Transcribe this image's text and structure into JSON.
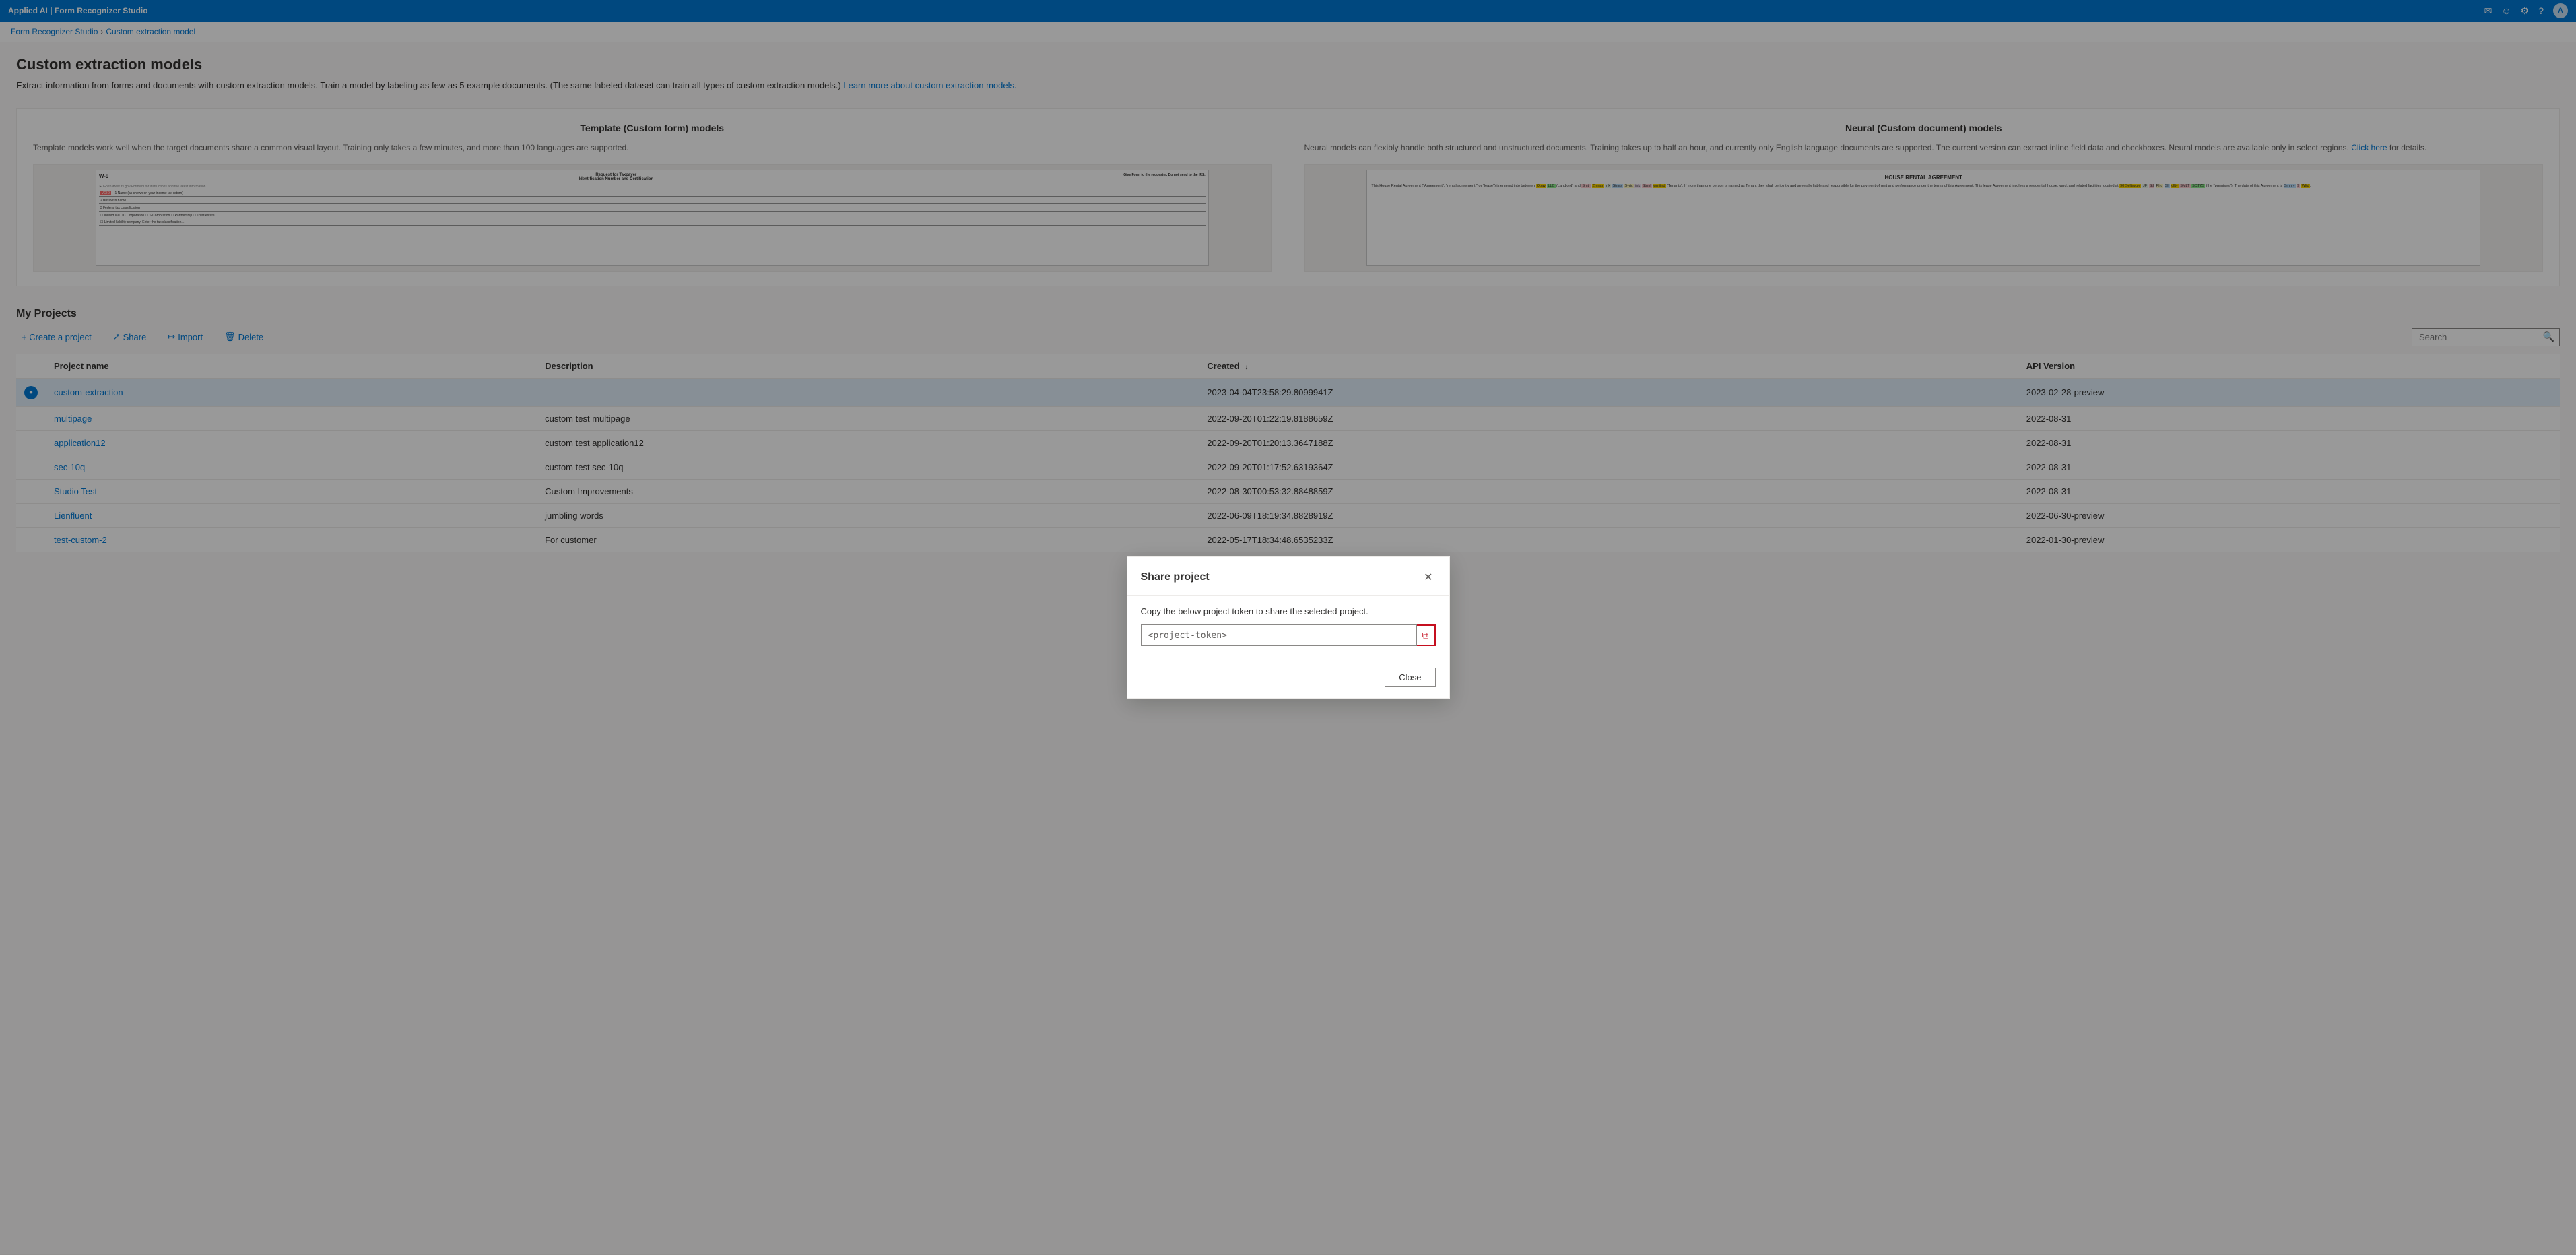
{
  "app": {
    "title": "Applied AI | Form Recognizer Studio",
    "topbar_icons": [
      "mail",
      "smiley",
      "settings",
      "help",
      "user"
    ]
  },
  "breadcrumb": {
    "parent": "Form Recognizer Studio",
    "current": "Custom extraction model"
  },
  "page": {
    "title": "Custom extraction models",
    "description": "Extract information from forms and documents with custom extraction models. Train a model by labeling as few as 5 example documents. (The same labeled dataset can train all types of custom extraction models.)",
    "link_text": "Learn more about custom extraction models.",
    "link_href": "#"
  },
  "template_card": {
    "title": "Template (Custom form) models",
    "description": "Template models work well when the target documents share a common visual layout. Training only takes a few minutes, and more than 100 languages are supported."
  },
  "neural_card": {
    "title": "Neural (Custom document) models",
    "description": "Neural models can flexibly handle both structured and unstructured documents. Training takes up to half an hour, and currently only English language documents are supported. The current version can extract inline field data and checkboxes. Neural models are available only in select regions.",
    "link_text": "Click here",
    "link_href": "#",
    "description_suffix": " for details."
  },
  "projects_section": {
    "title": "My Projects",
    "toolbar": {
      "create": "+ Create a project",
      "share": "Share",
      "import": "Import",
      "delete": "Delete"
    },
    "search_placeholder": "Search"
  },
  "table": {
    "columns": [
      "",
      "Project name",
      "Description",
      "Created ↓",
      "API Version"
    ],
    "rows": [
      {
        "indicator": true,
        "name": "custom-extraction",
        "description": "",
        "created": "2023-04-04T23:58:29.8099941Z",
        "api_version": "2023-02-28-preview"
      },
      {
        "indicator": false,
        "name": "multipage",
        "description": "custom test multipage",
        "created": "2022-09-20T01:22:19.8188659Z",
        "api_version": "2022-08-31"
      },
      {
        "indicator": false,
        "name": "application12",
        "description": "custom test application12",
        "created": "2022-09-20T01:20:13.3647188Z",
        "api_version": "2022-08-31"
      },
      {
        "indicator": false,
        "name": "sec-10q",
        "description": "custom test sec-10q",
        "created": "2022-09-20T01:17:52.6319364Z",
        "api_version": "2022-08-31"
      },
      {
        "indicator": false,
        "name": "Studio Test",
        "description": "Custom Improvements",
        "created": "2022-08-30T00:53:32.8848859Z",
        "api_version": "2022-08-31"
      },
      {
        "indicator": false,
        "name": "Lienfluent",
        "description": "jumbling words",
        "created": "2022-06-09T18:19:34.8828919Z",
        "api_version": "2022-06-30-preview"
      },
      {
        "indicator": false,
        "name": "test-custom-2",
        "description": "For customer",
        "created": "2022-05-17T18:34:48.6535233Z",
        "api_version": "2022-01-30-preview"
      }
    ]
  },
  "modal": {
    "title": "Share project",
    "description": "Copy the below project token to share the selected project.",
    "token_value": "<project-token>",
    "close_btn": "Close"
  }
}
